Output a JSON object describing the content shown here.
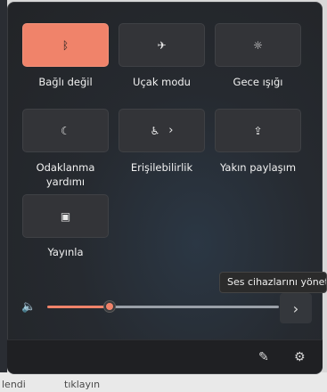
{
  "tiles": [
    {
      "label": "Bağlı değil",
      "icon": "bluetooth-icon",
      "active": true
    },
    {
      "label": "Uçak modu",
      "icon": "airplane-icon",
      "active": false
    },
    {
      "label": "Gece ışığı",
      "icon": "night-light-icon",
      "active": false
    },
    {
      "label": "Odaklanma yardımı",
      "icon": "focus-moon-icon",
      "active": false
    },
    {
      "label": "Erişilebilirlik",
      "icon": "accessibility-icon",
      "active": false
    },
    {
      "label": "Yakın paylaşım",
      "icon": "share-icon",
      "active": false
    },
    {
      "label": "Yayınla",
      "icon": "cast-icon",
      "active": false
    }
  ],
  "volume": {
    "icon": "speaker-icon",
    "level": 0.26
  },
  "tooltip": "Ses cihazlarını yönet",
  "footer": {
    "edit_icon": "pencil-icon",
    "settings_icon": "gear-icon"
  },
  "background_text": {
    "left": "lendi",
    "right": "tıklayın"
  },
  "colors": {
    "accent": "#f0836a",
    "panel": "#232528",
    "tile": "#333438"
  }
}
